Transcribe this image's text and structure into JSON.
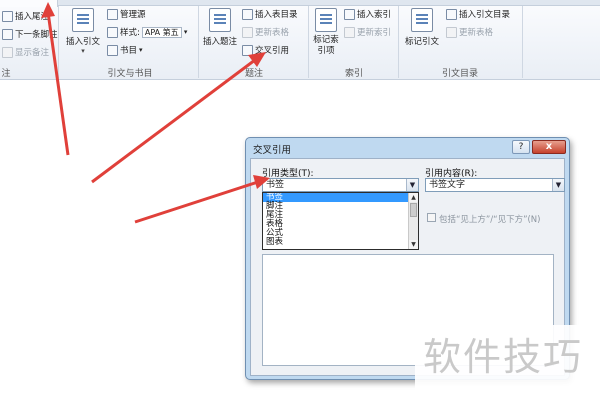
{
  "ribbon": {
    "footnotes": {
      "insert_endnote": "插入尾注",
      "next_footnote": "下一条脚注",
      "show_notes": "显示备注",
      "group_label": "注"
    },
    "citations": {
      "insert_citation": "插入引文",
      "manage_sources": "管理源",
      "style_label": "样式:",
      "style_value": "APA 第五",
      "bibliography": "书目",
      "group_label": "引文与书目"
    },
    "captions": {
      "insert_caption": "插入题注",
      "insert_table_of_figures": "插入表目录",
      "update_table": "更新表格",
      "cross_reference": "交叉引用",
      "group_label": "题注"
    },
    "index": {
      "mark_entry": "标记索引项",
      "insert_index": "插入索引",
      "update_index": "更新索引",
      "group_label": "索引"
    },
    "authorities": {
      "mark_citation": "标记引文",
      "insert_table_of_authorities": "插入引文目录",
      "update_table": "更新表格",
      "group_label": "引文目录"
    }
  },
  "dialog": {
    "title": "交叉引用",
    "help": "?",
    "close": "x",
    "reference_type_label": "引用类型(T):",
    "reference_type_value": "书签",
    "insert_reference_to_label": "引用内容(R):",
    "insert_reference_to_value": "书签文字",
    "include_above_below": "包括“见上方”/“见下方”(N)",
    "dropdown_items": [
      "书签",
      "脚注",
      "尾注",
      "表格",
      "公式",
      "图表"
    ],
    "dropdown_selected": 0
  },
  "watermark": "软件技巧",
  "colors": {
    "arrow": "#e0403a",
    "selection": "#3399ff",
    "dialog_frame": "#bfd9f0"
  }
}
